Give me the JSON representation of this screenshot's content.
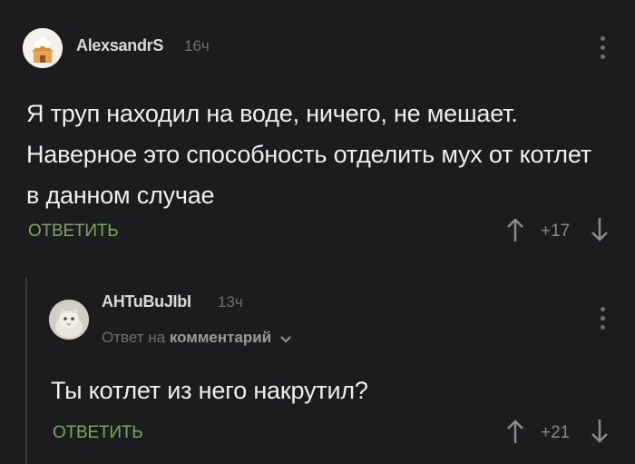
{
  "comments": [
    {
      "author": "AlexsandrS",
      "time": "16ч",
      "text": "Я труп находил на воде, ничего, не мешает. Наверное это способность отделить мух от котлет в данном случае",
      "reply_label": "ОТВЕТИТЬ",
      "score": "+17"
    },
    {
      "author": "AHTuBuJIbI",
      "time": "13ч",
      "reply_to_prefix": "Ответ на",
      "reply_to_link": "комментарий",
      "text": "Ты котлет из него накрутил?",
      "reply_label": "ОТВЕТИТЬ",
      "score": "+21"
    }
  ],
  "colors": {
    "background": "#1c1c1e",
    "reply_green": "#7da85b",
    "muted": "#707070",
    "text": "#efefef"
  },
  "icons": {
    "upvote": "arrow-up-icon",
    "downvote": "arrow-down-icon",
    "menu": "more-vertical-icon",
    "expand": "chevron-down-icon"
  }
}
